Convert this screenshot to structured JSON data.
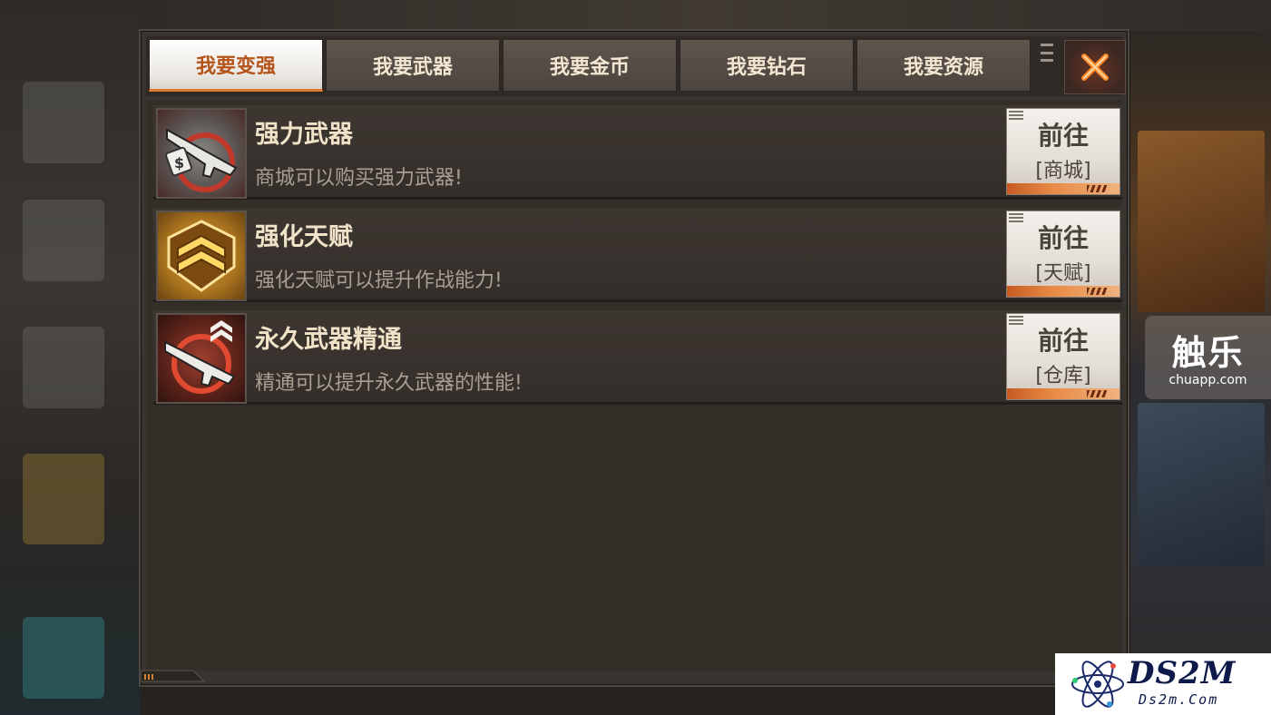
{
  "tabs": [
    {
      "label": "我要变强",
      "active": true
    },
    {
      "label": "我要武器",
      "active": false
    },
    {
      "label": "我要金币",
      "active": false
    },
    {
      "label": "我要钻石",
      "active": false
    },
    {
      "label": "我要资源",
      "active": false
    }
  ],
  "close_icon": "close-x-icon",
  "accent_color": "#e07a2c",
  "items": [
    {
      "icon": "rifle-price-tag-icon",
      "title": "强力武器",
      "desc": "商城可以购买强力武器!",
      "go_label": "前往",
      "go_dest": "[商城]"
    },
    {
      "icon": "gold-rank-chevron-icon",
      "title": "强化天赋",
      "desc": "强化天赋可以提升作战能力!",
      "go_label": "前往",
      "go_dest": "[天赋]"
    },
    {
      "icon": "rifle-upgrade-arrow-icon",
      "title": "永久武器精通",
      "desc": "精通可以提升永久武器的性能!",
      "go_label": "前往",
      "go_dest": "[仓库]"
    }
  ],
  "watermarks": {
    "chuapp_big": "触乐",
    "chuapp_small": "chuapp.com",
    "ds2m_name": "DS2M",
    "ds2m_url": "Ds2m.Com"
  }
}
